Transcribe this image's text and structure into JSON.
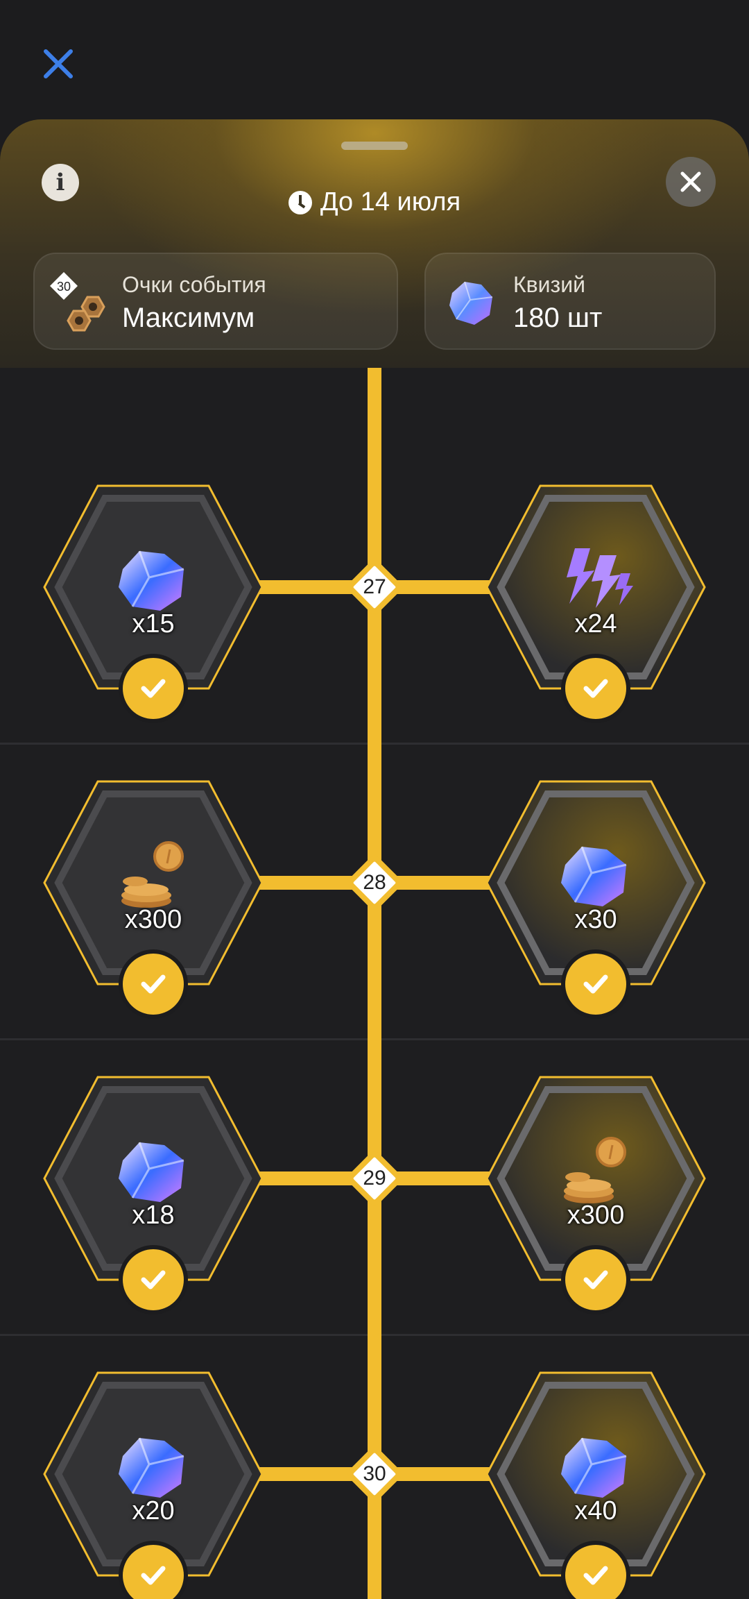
{
  "header": {
    "deadline": "До 14 июля"
  },
  "cards": {
    "event_points": {
      "label": "Очки события",
      "value": "Максимум",
      "level": "30"
    },
    "quizy": {
      "label": "Квизий",
      "value": "180 шт"
    }
  },
  "levels": [
    {
      "number": "27",
      "left": {
        "icon": "crystal-icon",
        "amount": "x15"
      },
      "right": {
        "icon": "lightning-icon",
        "amount": "x24"
      }
    },
    {
      "number": "28",
      "left": {
        "icon": "coins-icon",
        "amount": "x300"
      },
      "right": {
        "icon": "crystal-icon",
        "amount": "x30"
      }
    },
    {
      "number": "29",
      "left": {
        "icon": "crystal-icon",
        "amount": "x18"
      },
      "right": {
        "icon": "coins-icon",
        "amount": "x300"
      }
    },
    {
      "number": "30",
      "left": {
        "icon": "crystal-icon",
        "amount": "x20"
      },
      "right": {
        "icon": "crystal-icon",
        "amount": "x40"
      }
    }
  ],
  "colors": {
    "accent": "#f2bd2f",
    "background": "#1c1c1e",
    "close_blue": "#3d7fe8"
  }
}
